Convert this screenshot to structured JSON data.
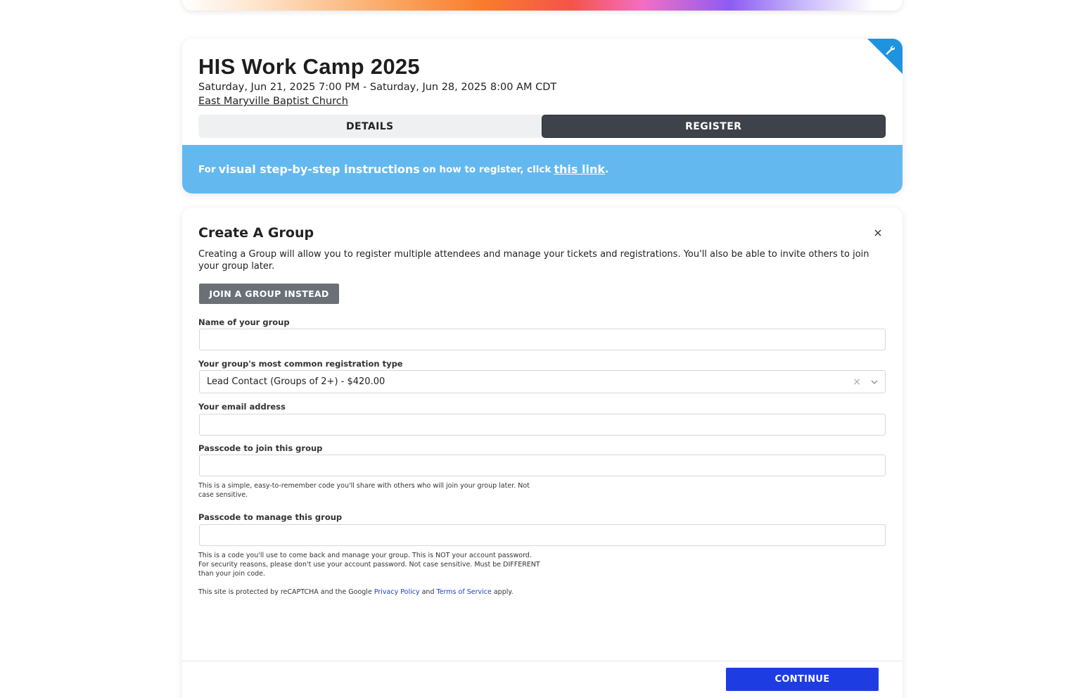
{
  "event": {
    "title": "HIS Work Camp 2025",
    "dates": "Saturday, Jun 21, 2025 7:00 PM - Saturday, Jun 28, 2025 8:00 AM CDT",
    "location": "East Maryville Baptist Church",
    "tabs": [
      {
        "label": "DETAILS",
        "active": false
      },
      {
        "label": "REGISTER",
        "active": true
      }
    ],
    "info": {
      "prefix": "For",
      "emphasis": "visual step-by-step instructions",
      "middle": "on how to register, click",
      "link": "this link",
      "suffix": "."
    },
    "admin_icon": "wrench-icon",
    "colors": {
      "info_bar": "#63b9ef",
      "active_tab": "#3e434b",
      "admin_corner": "#1e94e0"
    }
  },
  "group_form": {
    "title": "Create A Group",
    "description": "Creating a Group will allow you to register multiple attendees and manage your tickets and registrations. You'll also be able to invite others to join your group later.",
    "join_button": "JOIN A GROUP INSTEAD",
    "fields": {
      "group_name": {
        "label": "Name of your group",
        "value": ""
      },
      "registration_type": {
        "label": "Your group's most common registration type",
        "value": "Lead Contact (Groups of 2+) - $420.00"
      },
      "email": {
        "label": "Your email address",
        "value": ""
      },
      "join_passcode": {
        "label": "Passcode to join this group",
        "value": "",
        "help": "This is a simple, easy-to-remember code you'll share with others who will join your group later. Not case sensitive."
      },
      "manage_passcode": {
        "label": "Passcode to manage this group",
        "value": "",
        "help": "This is a code you'll use to come back and manage your group. This is NOT your account password. For security reasons, please don't use your account password. Not case sensitive. Must be DIFFERENT than your join code."
      }
    },
    "recaptcha": {
      "prefix": "This site is protected by reCAPTCHA and the Google",
      "privacy": "Privacy Policy",
      "and": "and",
      "terms": "Terms of Service",
      "suffix": "apply."
    },
    "continue_button": "CONTINUE",
    "colors": {
      "continue": "#1d3de3",
      "join_button": "#6b7076"
    }
  }
}
